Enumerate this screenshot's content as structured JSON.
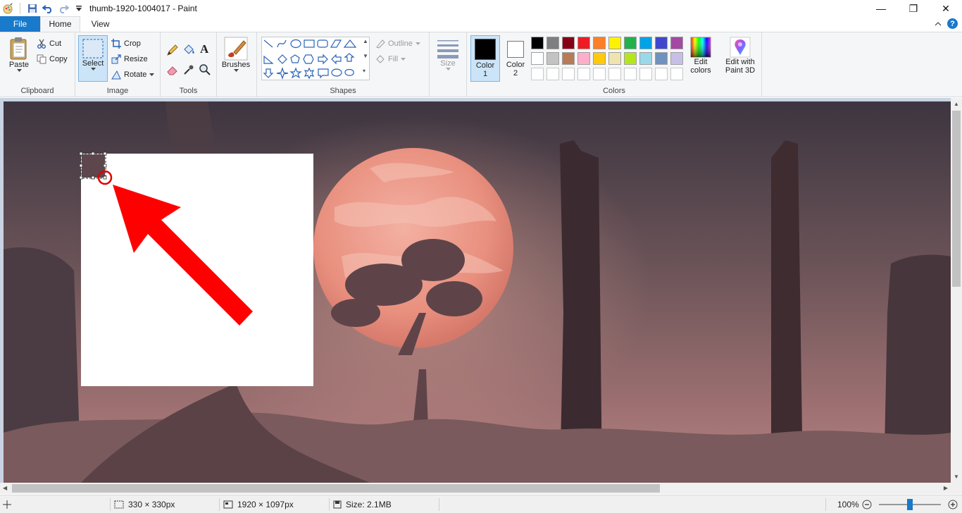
{
  "window": {
    "title": "thumb-1920-1004017 - Paint",
    "minimize_glyph": "—",
    "maximize_glyph": "❐",
    "close_glyph": "✕"
  },
  "tabs": {
    "file": "File",
    "home": "Home",
    "view": "View"
  },
  "ribbon": {
    "clipboard": {
      "label": "Clipboard",
      "paste": "Paste",
      "cut": "Cut",
      "copy": "Copy"
    },
    "image": {
      "label": "Image",
      "select": "Select",
      "crop": "Crop",
      "resize": "Resize",
      "rotate": "Rotate"
    },
    "tools": {
      "label": "Tools"
    },
    "brushes": {
      "label": "Brushes"
    },
    "shapes": {
      "label": "Shapes",
      "outline": "Outline",
      "fill": "Fill"
    },
    "size": {
      "label": "Size"
    },
    "colors": {
      "label": "Colors",
      "color1_line1": "Color",
      "color1_line2": "1",
      "color2_line1": "Color",
      "color2_line2": "2",
      "edit_line1": "Edit",
      "edit_line2": "colors",
      "paint3d_line1": "Edit with",
      "paint3d_line2": "Paint 3D",
      "color1_value": "#000000",
      "color2_value": "#ffffff",
      "palette_row1": [
        "#000000",
        "#7f7f7f",
        "#880015",
        "#ed1c24",
        "#ff7f27",
        "#fff200",
        "#22b14c",
        "#00a2e8",
        "#3f48cc",
        "#a349a4"
      ],
      "palette_row2": [
        "#ffffff",
        "#c3c3c3",
        "#b97a57",
        "#ffaec9",
        "#ffc90e",
        "#efe4b0",
        "#b5e61d",
        "#99d9ea",
        "#7092be",
        "#c8bfe7"
      ],
      "palette_row3": [
        "#ffffff",
        "#ffffff",
        "#ffffff",
        "#ffffff",
        "#ffffff",
        "#ffffff",
        "#ffffff",
        "#ffffff",
        "#ffffff",
        "#ffffff"
      ]
    }
  },
  "status": {
    "selection_size": "330 × 330px",
    "image_size": "1920 × 1097px",
    "file_size": "Size: 2.1MB",
    "zoom": "100%",
    "zoom_level": 0.5
  }
}
